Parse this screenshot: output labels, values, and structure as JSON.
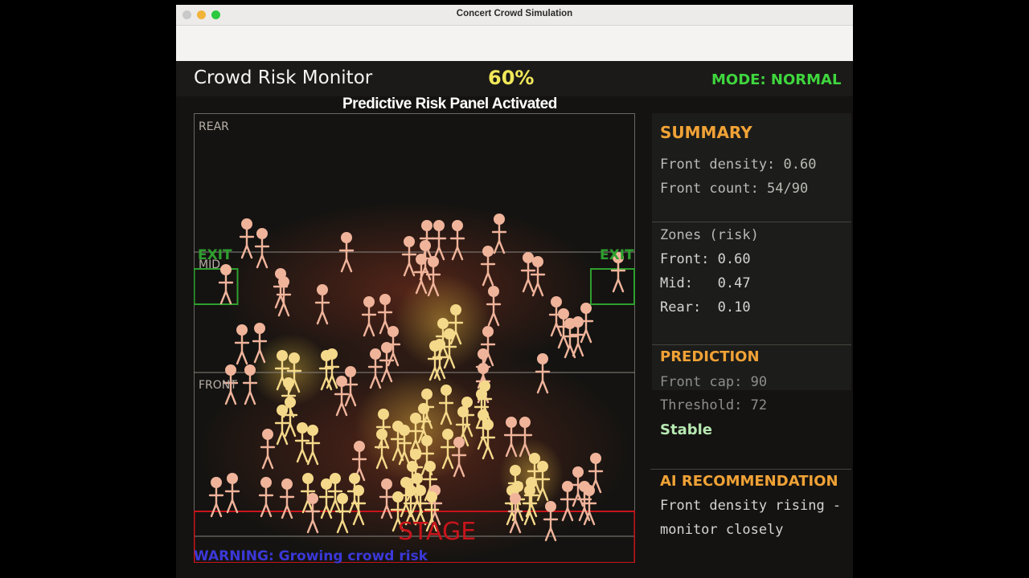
{
  "window": {
    "title": "Concert Crowd Simulation"
  },
  "header": {
    "title": "Crowd Risk Monitor",
    "percent": "60%",
    "mode": "MODE: NORMAL",
    "subtitle": "Predictive Risk Panel Activated"
  },
  "field": {
    "zones": {
      "rear": "REAR",
      "mid": "MID",
      "front": "FRONT"
    },
    "exit_left": "EXIT",
    "exit_right": "EXIT",
    "stage": "STAGE",
    "warning": "WARNING: Growing crowd risk"
  },
  "summary": {
    "heading": "SUMMARY",
    "front_density": "Front density: 0.60",
    "front_count": "Front count: 54/90"
  },
  "zones_risk": {
    "heading": "Zones (risk)",
    "front": "Front: 0.60",
    "mid": "Mid:   0.47",
    "rear": "Rear:  0.10"
  },
  "prediction": {
    "heading": "PREDICTION",
    "front_cap": "Front cap: 90",
    "threshold": "Threshold: 72",
    "status": "Stable"
  },
  "recommendation": {
    "heading": "AI RECOMMENDATION",
    "line1": "Front density rising -",
    "line2": "monitor closely"
  },
  "colors": {
    "person": "#f0b49b",
    "person_hot": "#f5d98a",
    "exit": "#2ea02e",
    "stage": "#c8141b",
    "accent_heading": "#f0a236",
    "mode": "#3fd63e",
    "percent": "#f1e85a",
    "warning": "#3b38d8"
  }
}
